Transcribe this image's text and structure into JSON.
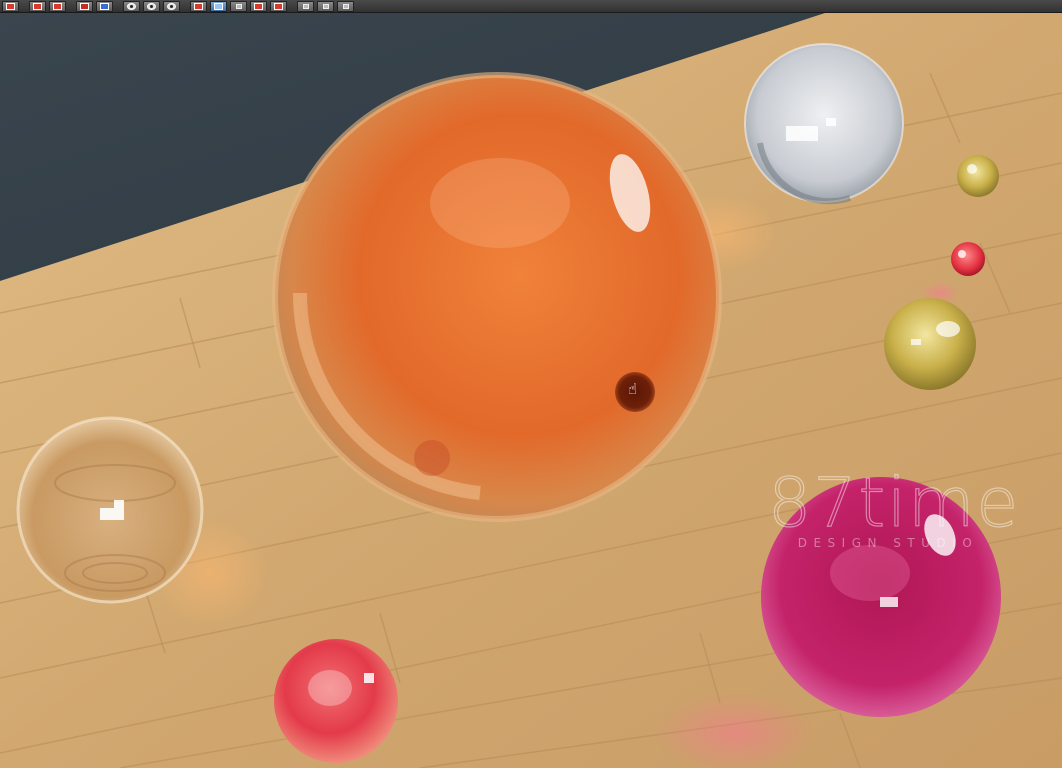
{
  "toolbar": {
    "buttons": [
      {
        "name": "render-frame-button",
        "icon": "render-icon",
        "active": false
      },
      {
        "name": "render-region-button",
        "icon": "region-icon",
        "active": false
      },
      {
        "name": "render-last-button",
        "icon": "render-last-icon",
        "active": false
      },
      {
        "name": "clone-render-button",
        "icon": "clone-icon",
        "active": false
      },
      {
        "name": "view-lights-button",
        "icon": "eye-icon",
        "active": false
      },
      {
        "name": "view-mask-button",
        "icon": "eye-icon",
        "active": false
      },
      {
        "name": "view-alpha-button",
        "icon": "eye-icon",
        "active": false
      },
      {
        "name": "track-mouse-button",
        "icon": "track-icon",
        "active": false
      },
      {
        "name": "color-correct-button",
        "icon": "color-icon",
        "active": true
      },
      {
        "name": "save-image-button",
        "icon": "save-icon",
        "active": false
      },
      {
        "name": "link-button",
        "icon": "link-icon",
        "active": false
      },
      {
        "name": "history-button",
        "icon": "history-icon",
        "active": false
      },
      {
        "name": "clear-button",
        "icon": "clear-icon",
        "active": false
      },
      {
        "name": "options-button",
        "icon": "options-icon",
        "active": false
      },
      {
        "name": "settings-button",
        "icon": "settings-icon",
        "active": false
      }
    ]
  },
  "watermark": {
    "logo": "87time",
    "subtitle": "DESIGN STUDIO"
  },
  "cursor": {
    "icon": "hand-icon"
  },
  "colors": {
    "floor": "#c9a06a",
    "wall": "#3a4650",
    "orange_sphere": "#e8742c",
    "magenta_sphere": "#c2185b",
    "red_sphere": "#e63947",
    "clear_sphere": "#d9dee4",
    "gold_sphere": "#c9b04a"
  }
}
